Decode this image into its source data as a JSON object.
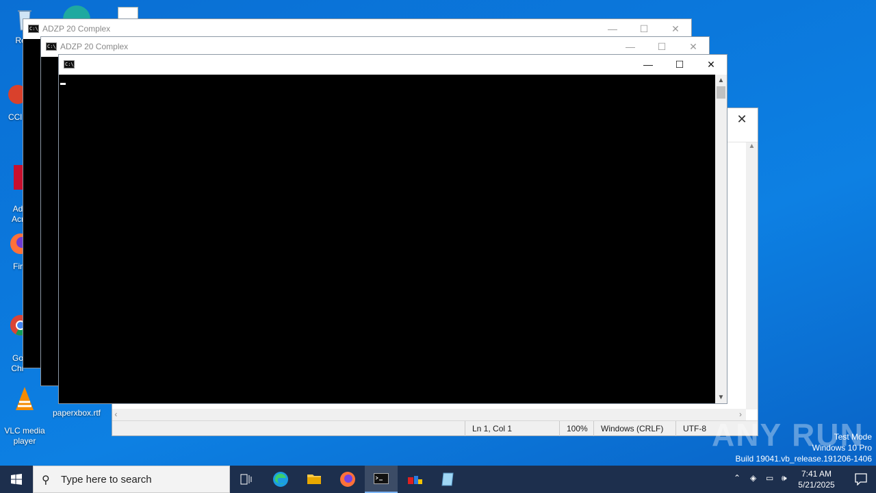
{
  "desktop": {
    "icons": [
      {
        "label": "Recy"
      },
      {
        "label": "CCl"
      },
      {
        "label": "Ad\nAcr"
      },
      {
        "label": "Fir"
      },
      {
        "label": "Go\nChr"
      },
      {
        "label": "VLC media\nplayer"
      },
      {
        "label": "paperxbox.rtf"
      }
    ]
  },
  "notepad": {
    "close_glyph": "✕",
    "status": {
      "position": "Ln 1, Col 1",
      "zoom": "100%",
      "line_endings": "Windows (CRLF)",
      "encoding": "UTF-8"
    }
  },
  "consoles": [
    {
      "title": "ADZP 20 Complex"
    },
    {
      "title": "ADZP 20 Complex"
    },
    {
      "title": ""
    }
  ],
  "window_controls": {
    "minimize": "—",
    "maximize": "☐",
    "close": "✕"
  },
  "watermark": {
    "brand": "ANY RUN",
    "line1": "Test Mode",
    "line2": "Windows 10 Pro",
    "line3": "Build 19041.vb_release.191206-1406"
  },
  "taskbar": {
    "search_placeholder": "Type here to search",
    "time": "7:41 AM",
    "date": "5/21/2025"
  }
}
